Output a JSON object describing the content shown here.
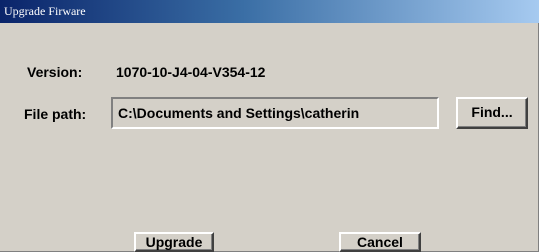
{
  "window": {
    "title": "Upgrade Firware"
  },
  "form": {
    "version_label": "Version:",
    "version_value": "1070-10-J4-04-V354-12",
    "file_path_label": "File path:",
    "file_path_value": "C:\\Documents and Settings\\catherin",
    "find_label": "Find..."
  },
  "actions": {
    "upgrade_label": "Upgrade",
    "cancel_label": "Cancel"
  },
  "colors": {
    "dialog_background": "#d4d0c8",
    "titlebar_start": "#0a246a",
    "titlebar_end": "#a6caf0",
    "title_text": "#ffffff"
  }
}
